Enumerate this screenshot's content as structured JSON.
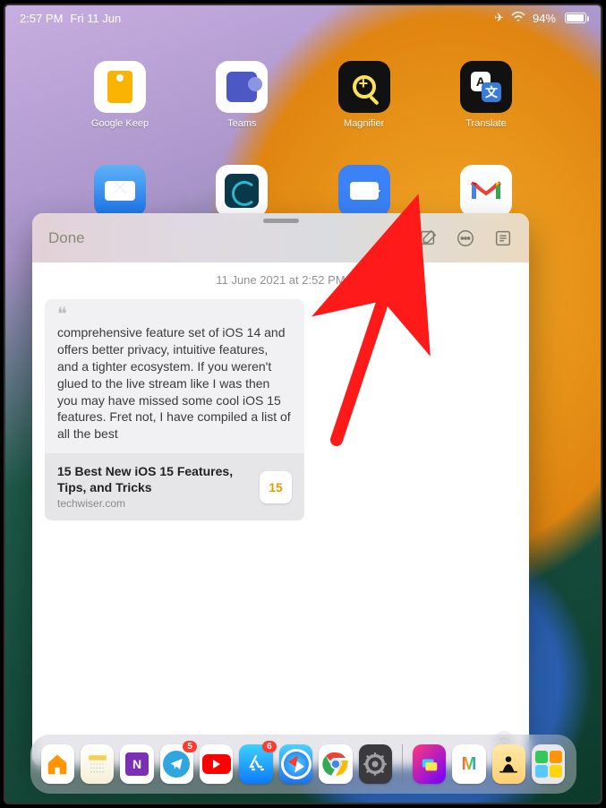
{
  "status": {
    "time": "2:57 PM",
    "date": "Fri 11 Jun",
    "battery_pct": "94%"
  },
  "home_apps_row1": [
    {
      "name": "Google Keep"
    },
    {
      "name": "Teams"
    },
    {
      "name": "Magnifier"
    },
    {
      "name": "Translate"
    }
  ],
  "home_apps_row2": [
    {
      "name": "Mail"
    },
    {
      "name": "SwiftKey"
    },
    {
      "name": "Zoom"
    },
    {
      "name": "Gmail"
    }
  ],
  "note": {
    "done_label": "Done",
    "date_line": "11 June 2021 at 2:52 PM",
    "quote_body": "comprehensive feature set of iOS 14 and offers better privacy, intuitive features, and a tighter ecosystem. If you weren't glued to the live stream like I was then you may have missed some cool iOS 15 features. Fret not, I have compiled a list of all the best",
    "link_title": "15 Best New iOS 15 Features, Tips, and Tricks",
    "link_domain": "techwiser.com",
    "link_badge": "15"
  },
  "translate": {
    "a": "A",
    "b": "文"
  },
  "dock": {
    "telegram_badge": "5",
    "appstore_badge": "6"
  }
}
